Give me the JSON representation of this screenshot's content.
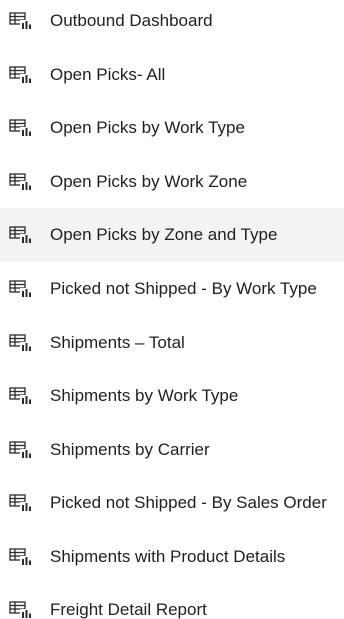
{
  "reports": {
    "icon": "table-chart-report-icon",
    "hover_color": "#f4f3f1",
    "items": [
      {
        "label": "Outbound Dashboard"
      },
      {
        "label": "Open Picks- All"
      },
      {
        "label": "Open Picks by Work Type"
      },
      {
        "label": "Open Picks by Work Zone"
      },
      {
        "label": "Open Picks by Zone and Type",
        "highlighted": true
      },
      {
        "label": "Picked not Shipped - By Work Type"
      },
      {
        "label": "Shipments – Total"
      },
      {
        "label": "Shipments by Work Type"
      },
      {
        "label": "Shipments by Carrier"
      },
      {
        "label": "Picked not Shipped - By Sales Order"
      },
      {
        "label": "Shipments with Product Details"
      },
      {
        "label": "Freight Detail Report"
      }
    ]
  }
}
